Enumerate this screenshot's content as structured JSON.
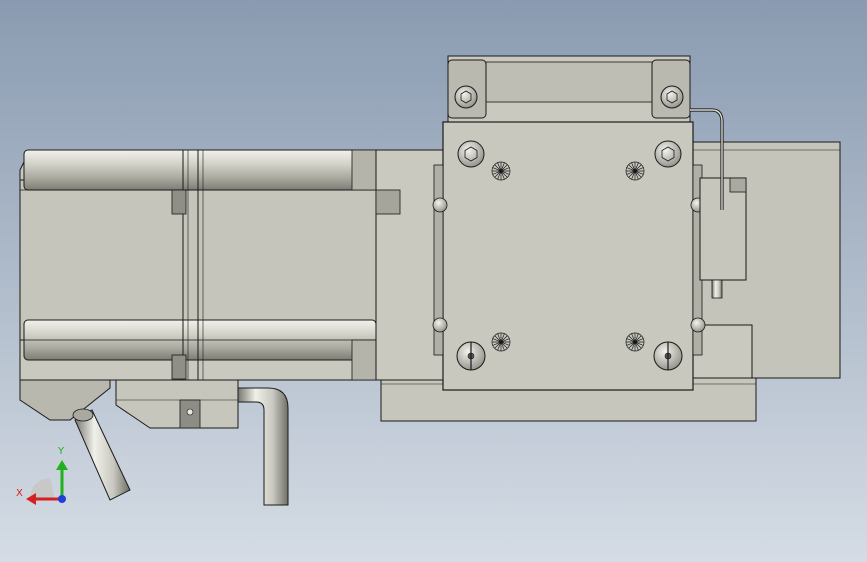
{
  "viewport": {
    "background_top": "#8a9bb1",
    "background_bottom": "#d5dce5",
    "part_fill": "#c9c9bf",
    "part_fill_dark": "#a8a89e",
    "part_stroke": "#1a1a1a"
  },
  "triad": {
    "x_label": "X",
    "y_label": "Y",
    "x_color": "#d42020",
    "y_color": "#20b020",
    "z_color": "#1f3fd6"
  }
}
